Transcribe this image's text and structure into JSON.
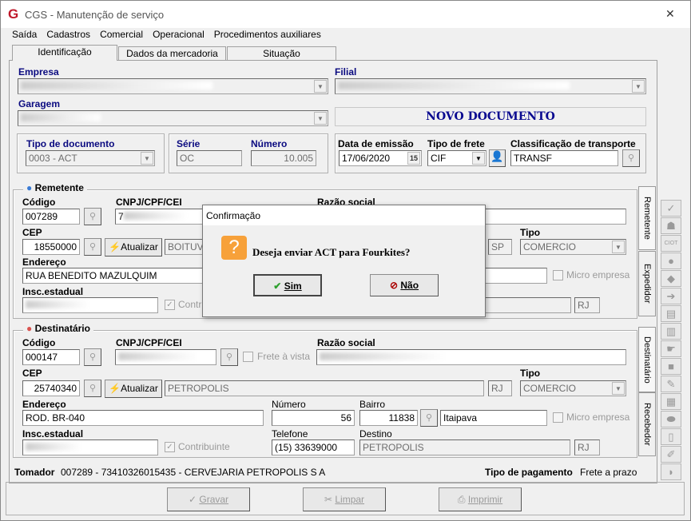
{
  "window": {
    "title": "CGS - Manutenção de serviço",
    "close": "✕",
    "logo": "G"
  },
  "menu": [
    "Saída",
    "Cadastros",
    "Comercial",
    "Operacional",
    "Procedimentos auxiliares"
  ],
  "tabs": [
    "Identificação",
    "Dados da mercadoria",
    "Situação"
  ],
  "ident": {
    "empresa_label": "Empresa",
    "filial_label": "Filial",
    "garagem_label": "Garagem",
    "status": "NOVO DOCUMENTO",
    "tipo_doc_label": "Tipo de documento",
    "tipo_doc": "0003 - ACT",
    "serie_label": "Série",
    "serie": "OC",
    "numero_label": "Número",
    "numero": "10.005",
    "data_label": "Data de emissão",
    "data": "17/06/2020",
    "cal": "15",
    "frete_label": "Tipo de frete",
    "frete": "CIF",
    "class_label": "Classificação de transporte",
    "class": "TRANSF"
  },
  "remetente": {
    "title": "Remetente",
    "codigo_label": "Código",
    "codigo": "007289",
    "cnpj_label": "CNPJ/CPF/CEI",
    "cnpj_prefix": "7",
    "razao_label": "Razão social",
    "cep_label": "CEP",
    "cep": "18550000",
    "atualizar": "Atualizar",
    "cidade": "BOITUVA",
    "uf": "SP",
    "tipo_label": "Tipo",
    "tipo": "COMERCIO",
    "endereco_label": "Endereço",
    "endereco": "RUA BENEDITO MAZULQUIM",
    "micro": "Micro empresa",
    "insc_label": "Insc.estadual",
    "contrib": "Contribuinte",
    "dest_uf": "RJ"
  },
  "destinatario": {
    "title": "Destinatário",
    "codigo_label": "Código",
    "codigo": "000147",
    "cnpj_label": "CNPJ/CPF/CEI",
    "frete_vista": "Frete à vista",
    "razao_label": "Razão social",
    "cep_label": "CEP",
    "cep": "25740340",
    "atualizar": "Atualizar",
    "cidade": "PETROPOLIS",
    "uf": "RJ",
    "tipo_label": "Tipo",
    "tipo": "COMERCIO",
    "endereco_label": "Endereço",
    "endereco": "ROD. BR-040",
    "numero_label": "Número",
    "numero": "56",
    "bairro_label": "Bairro",
    "bairro_cod": "11838",
    "bairro": "Itaipava",
    "micro": "Micro empresa",
    "insc_label": "Insc.estadual",
    "contrib": "Contribuinte",
    "tel_label": "Telefone",
    "telefone": "(15) 33639000",
    "destino_label": "Destino",
    "destino": "PETROPOLIS",
    "destino_uf": "RJ"
  },
  "side_tabs": [
    "Remetente",
    "Expedidor",
    "Destinatário",
    "Recebedor"
  ],
  "footer": {
    "tomador_label": "Tomador",
    "tomador": "007289 - 73410326015435 - CERVEJARIA PETROPOLIS S A",
    "pag_label": "Tipo de pagamento",
    "pag": "Frete a prazo"
  },
  "buttons": {
    "gravar": "Gravar",
    "limpar": "Limpar",
    "imprimir": "Imprimir"
  },
  "dialog": {
    "title": "Confirmação",
    "message": "Deseja enviar ACT para Fourkites?",
    "yes": "Sim",
    "no": "Não",
    "icon": "?"
  },
  "colors": {
    "label_blue": "#0a0a80",
    "logo_red": "#c0182a",
    "question_orange": "#f7a13a"
  }
}
